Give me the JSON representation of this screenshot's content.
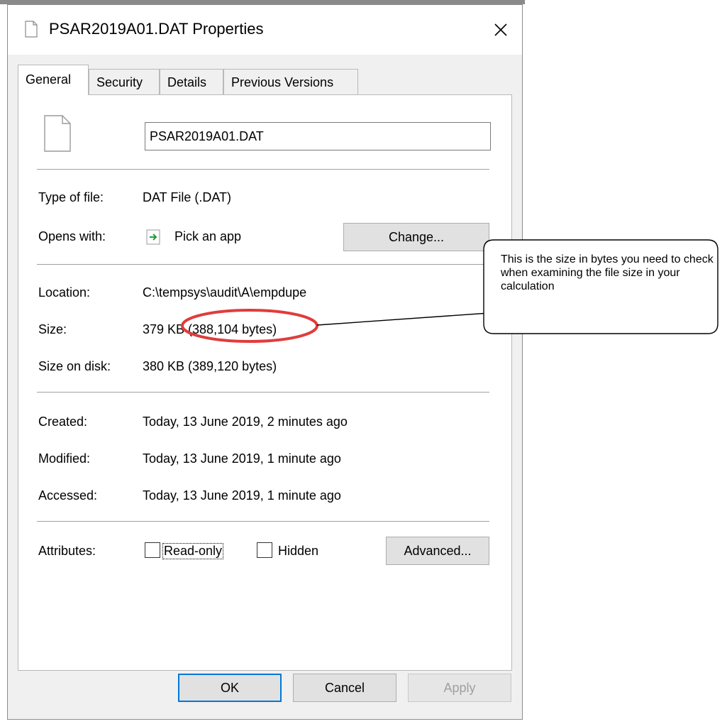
{
  "window": {
    "title": "PSAR2019A01.DAT Properties"
  },
  "tabs": [
    {
      "label": "General",
      "active": true
    },
    {
      "label": "Security",
      "active": false
    },
    {
      "label": "Details",
      "active": false
    },
    {
      "label": "Previous Versions",
      "active": false
    }
  ],
  "general": {
    "file_name": "PSAR2019A01.DAT",
    "type_label": "Type of file:",
    "type_value": "DAT File (.DAT)",
    "opens_label": "Opens with:",
    "opens_value": "Pick an app",
    "change_button": "Change...",
    "location_label": "Location:",
    "location_value": "C:\\tempsys\\audit\\A\\empdupe",
    "size_label": "Size:",
    "size_value": "379 KB (388,104 bytes)",
    "size_on_disk_label": "Size on disk:",
    "size_on_disk_value": "380 KB (389,120 bytes)",
    "created_label": "Created:",
    "created_value": "Today, 13 June 2019, 2 minutes ago",
    "modified_label": "Modified:",
    "modified_value": "Today, 13 June 2019, 1 minute ago",
    "accessed_label": "Accessed:",
    "accessed_value": "Today, 13 June 2019, 1 minute ago",
    "attributes_label": "Attributes:",
    "readonly_label": "Read-only",
    "readonly_checked": false,
    "hidden_label": "Hidden",
    "hidden_checked": false,
    "advanced_button": "Advanced..."
  },
  "footer": {
    "ok": "OK",
    "cancel": "Cancel",
    "apply": "Apply"
  },
  "callout": {
    "text": "This is the size in bytes you need to check when examining the file size in your calculation"
  },
  "colors": {
    "highlight_ellipse": "#e03c3c",
    "focus_border": "#0078d7",
    "opens_with_icon": "#1e9e3a"
  }
}
